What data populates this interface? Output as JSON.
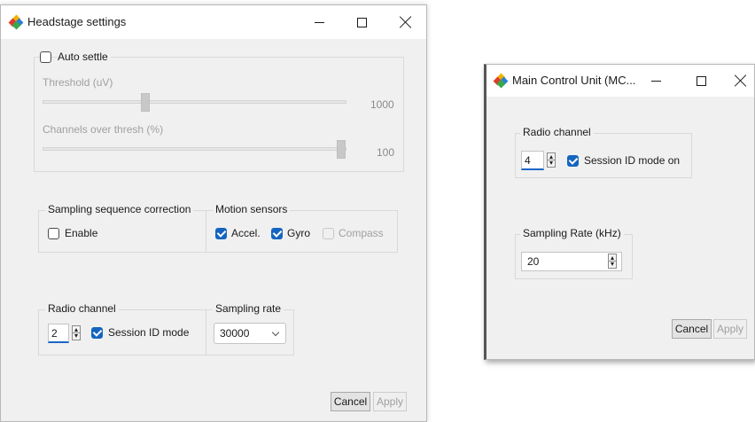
{
  "headstage_window": {
    "title": "Headstage settings",
    "auto_settle": {
      "label": "Auto settle",
      "checked": false,
      "threshold_label": "Threshold (uV)",
      "threshold_value": "1000",
      "channels_label": "Channels over thresh (%)",
      "channels_value": "100"
    },
    "sampling_sequence": {
      "title": "Sampling sequence correction",
      "enable_label": "Enable",
      "enable_checked": false
    },
    "motion_sensors": {
      "title": "Motion sensors",
      "accel_label": "Accel.",
      "gyro_label": "Gyro",
      "compass_label": "Compass"
    },
    "radio_channel": {
      "title": "Radio channel",
      "value": "2",
      "session_label": "Session ID mode"
    },
    "sampling_rate": {
      "title": "Sampling rate",
      "selected": "30000"
    },
    "buttons": {
      "cancel": "Cancel",
      "apply": "Apply"
    }
  },
  "mcu_window": {
    "title": "Main Control Unit (MC...",
    "radio_channel": {
      "title": "Radio channel",
      "value": "4",
      "session_label": "Session ID mode on"
    },
    "sampling_rate": {
      "title": "Sampling Rate (kHz)",
      "value": "20"
    },
    "buttons": {
      "cancel": "Cancel",
      "apply": "Apply"
    }
  },
  "colors": {
    "accent": "#1565c0",
    "window_bg": "#f0f0f0",
    "titlebar_bg": "#ffffff"
  },
  "icons": [
    "app-icon",
    "minimize-icon",
    "maximize-icon",
    "close-icon",
    "spin-up-down-icon",
    "chevron-down-icon",
    "checkmark-icon"
  ]
}
